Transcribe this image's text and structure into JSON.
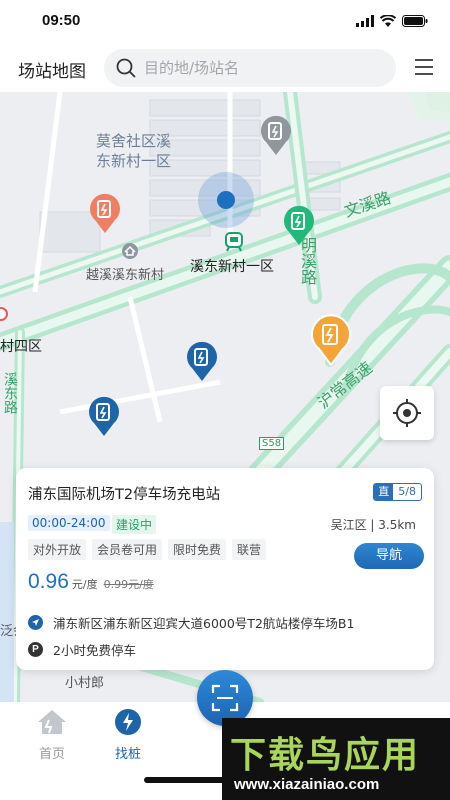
{
  "status_bar": {
    "time": "09:50"
  },
  "header": {
    "title": "场站地图",
    "search_placeholder": "目的地/场站名"
  },
  "map": {
    "labels": {
      "area1_line1": "莫舍社区溪",
      "area1_line2": "东新村一区",
      "road_wenxi": "文溪路",
      "road_mingxi": "明溪路",
      "poi_yuexi": "越溪溪东新村",
      "poi_xidong": "溪东新村一区",
      "area_cun4": "村四区",
      "road_huchang": "沪常高速",
      "road_side": "溪东路",
      "road_sign": "S58",
      "village": "小村郎",
      "edge_text": "泛会"
    }
  },
  "station_card": {
    "name": "浦东国际机场T2停车场充电站",
    "counter_type": "直",
    "counter_value": "5/8",
    "hours": "00:00-24:00",
    "status": "建设中",
    "district": "吴江区 | 3.5km",
    "tags": [
      "对外开放",
      "会员卷可用",
      "限时免费",
      "联营"
    ],
    "navigate_label": "导航",
    "price": "0.96",
    "price_unit": "元/度",
    "price_original": "0.99元/度",
    "address": "浦东新区浦东新区迎宾大道6000号T2航站楼停车场B1",
    "parking": "2小时免费停车"
  },
  "tabbar": {
    "tabs": [
      {
        "label": "首页"
      },
      {
        "label": "找桩"
      }
    ]
  },
  "watermark": {
    "title": "下载鸟应用",
    "url": "www.xiazainiao.com"
  },
  "colors": {
    "accent": "#1e6fbf",
    "road_green": "#8fd4b0",
    "status_green": "#23a56a"
  }
}
